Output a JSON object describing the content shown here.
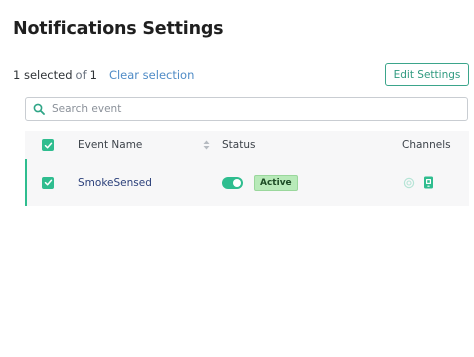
{
  "header": {
    "title": "Notifications Settings"
  },
  "selection": {
    "selected_label": "1 selected",
    "of_label": "of",
    "total": "1",
    "clear_label": "Clear selection"
  },
  "toolbar": {
    "edit_label": "Edit Settings"
  },
  "search": {
    "placeholder": "Search event",
    "value": ""
  },
  "table": {
    "columns": {
      "event": "Event Name",
      "status": "Status",
      "channels": "Channels"
    },
    "rows": [
      {
        "selected": true,
        "event_name": "SmokeSensed",
        "enabled": true,
        "status_label": "Active",
        "channels": [
          "bell-icon",
          "sms-icon"
        ]
      }
    ]
  },
  "colors": {
    "accent": "#2fbd8f",
    "link": "#4f8bc6",
    "badge_bg": "#b8eab9",
    "event_name": "#2a3f7a"
  }
}
